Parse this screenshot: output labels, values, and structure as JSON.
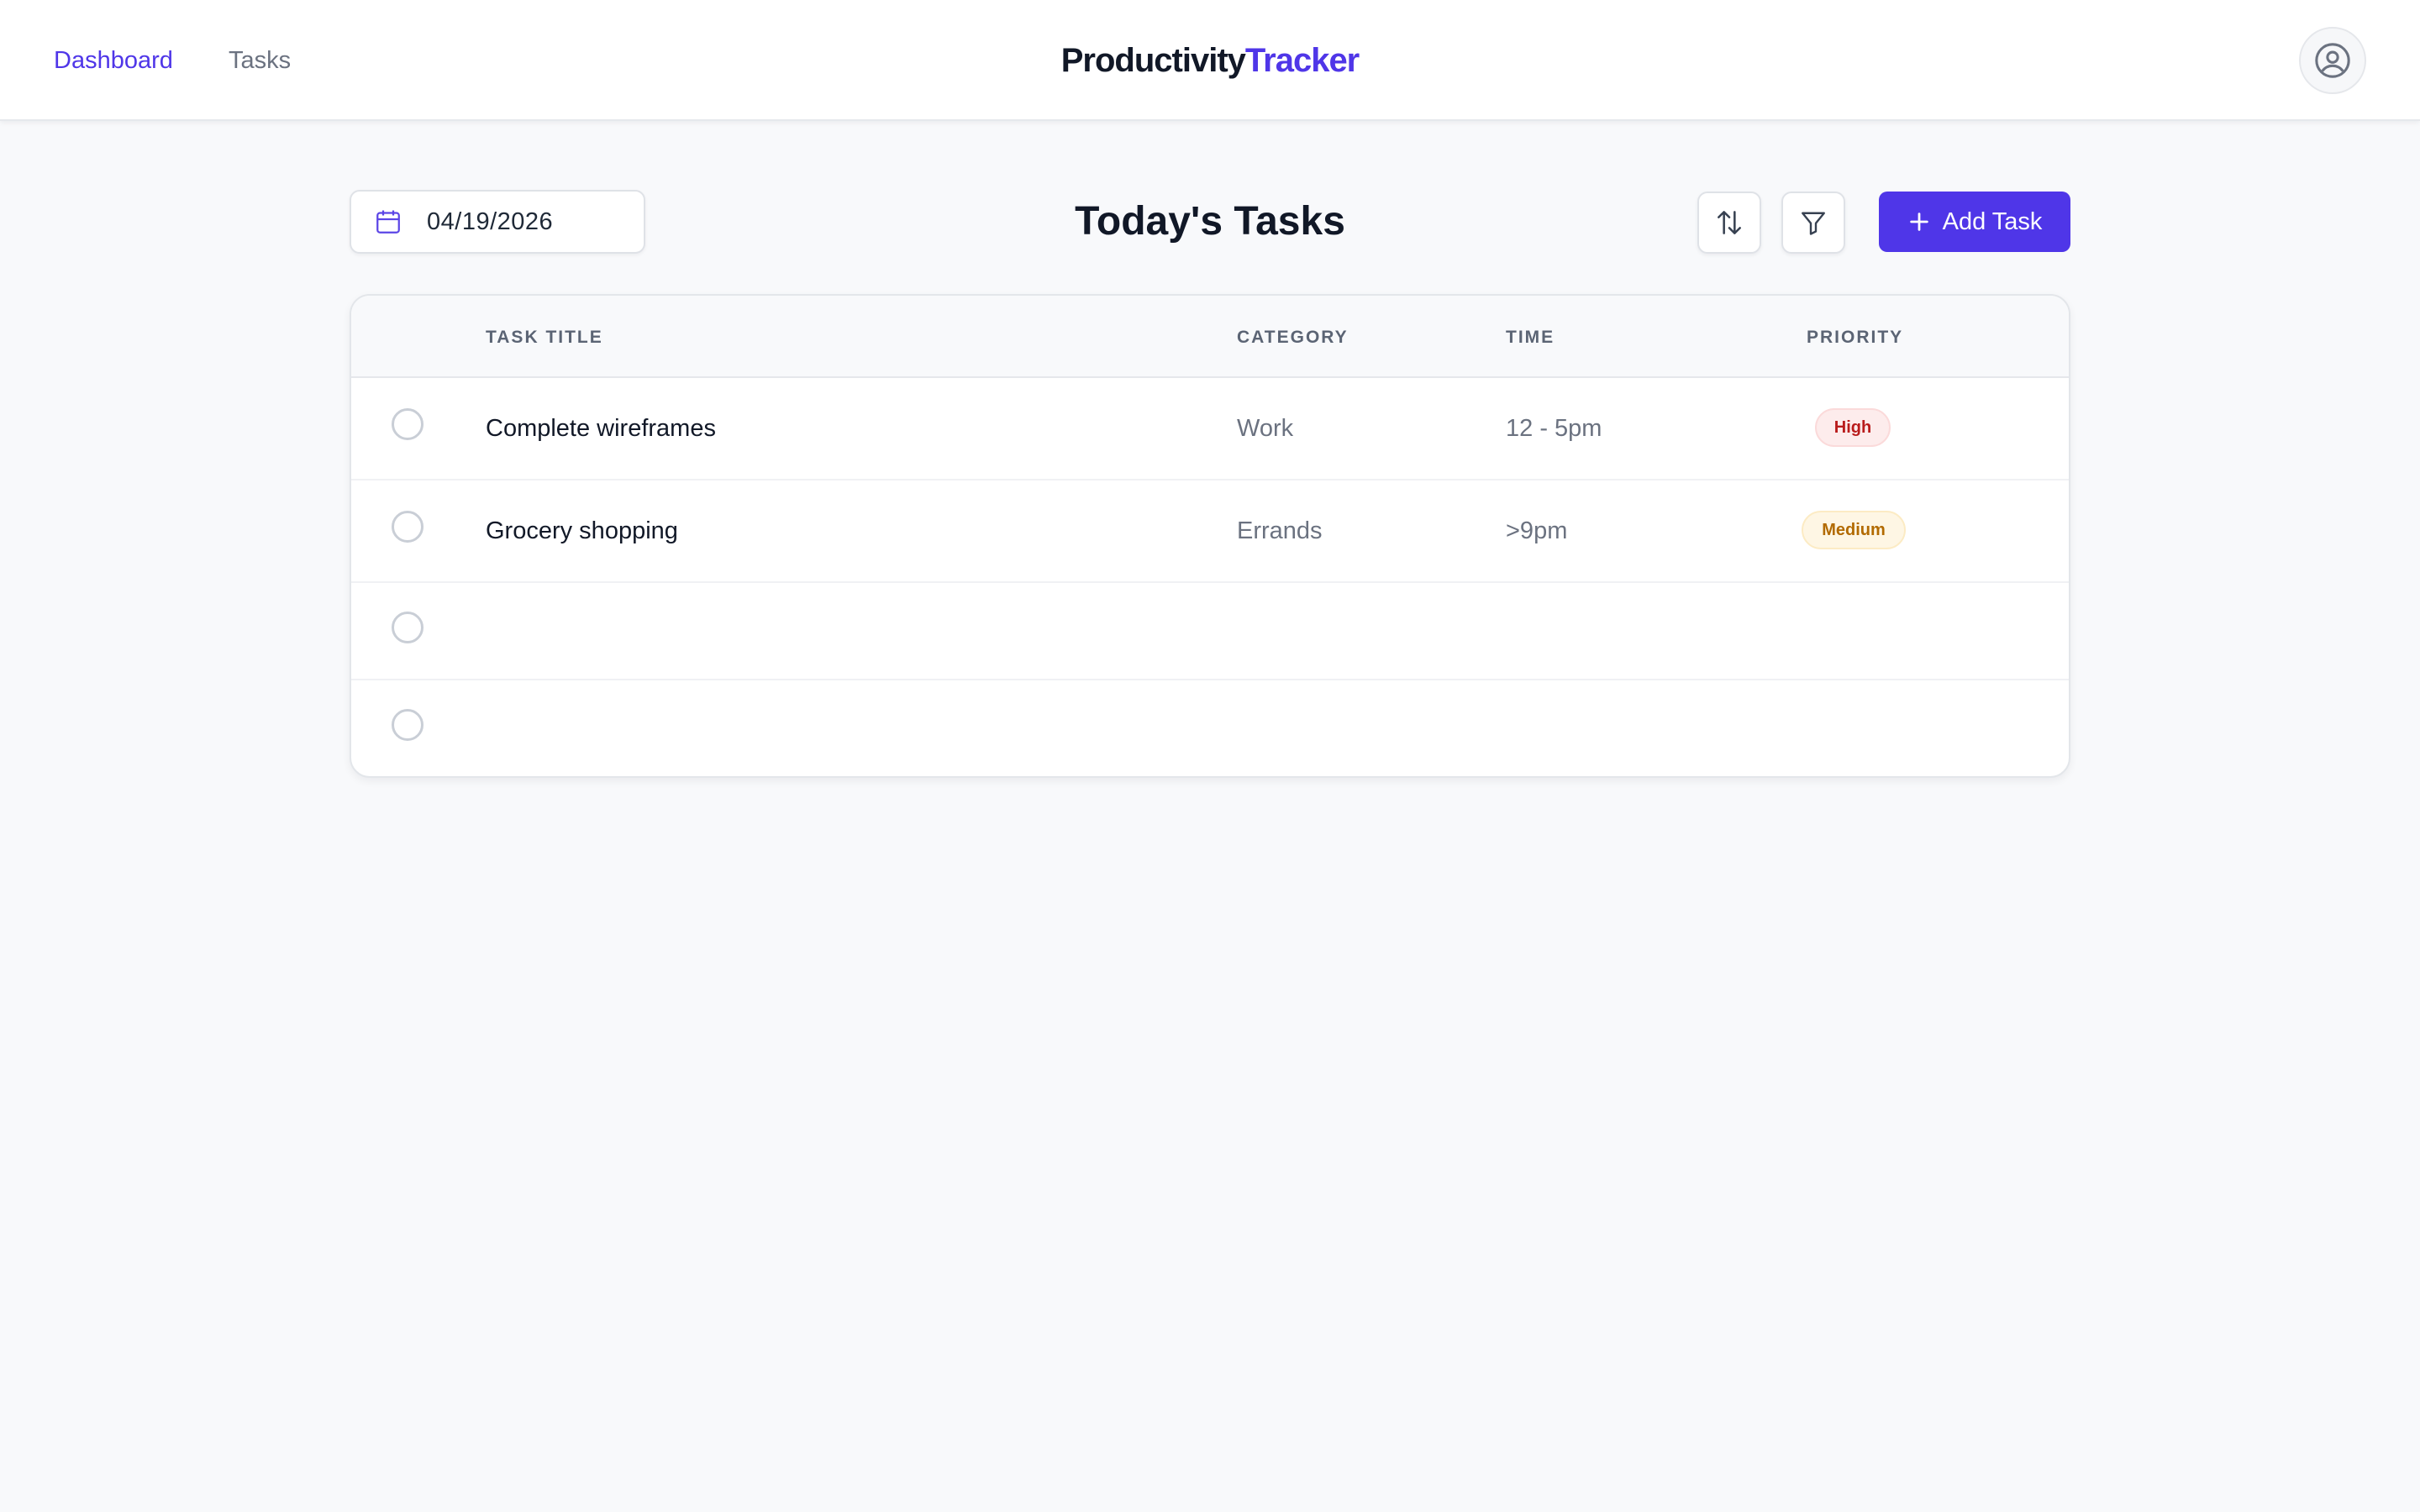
{
  "nav": {
    "links": [
      {
        "label": "Dashboard",
        "active": true
      },
      {
        "label": "Tasks",
        "active": false
      }
    ]
  },
  "brand": {
    "part1": "Productivity",
    "part2": "Tracker",
    "accent": "#4f36e8"
  },
  "user": {
    "avatar_icon": "user-circle-icon"
  },
  "toolbar": {
    "date_value": "04/19/2026",
    "date_icon": "calendar-icon",
    "title": "Today's Tasks",
    "sort_icon": "sort-arrows-icon",
    "filter_icon": "filter-icon",
    "add_label": "Add Task",
    "add_icon": "plus-icon"
  },
  "table": {
    "headers": [
      "TASK TITLE",
      "CATEGORY",
      "TIME",
      "PRIORITY"
    ],
    "rows": [
      {
        "title": "Complete wireframes",
        "category": "Work",
        "time": "12 - 5pm",
        "priority": "High",
        "done": false
      },
      {
        "title": "Grocery shopping",
        "category": "Errands",
        "time": ">9pm",
        "priority": "Medium",
        "done": false
      },
      {
        "title": "",
        "category": "",
        "time": "",
        "priority": "",
        "done": false
      },
      {
        "title": "",
        "category": "",
        "time": "",
        "priority": "",
        "done": false
      }
    ]
  },
  "colors": {
    "primary": "#4f36e8",
    "high_bg": "#fdecec",
    "high_text": "#b91c1c",
    "medium_bg": "#fef6e4",
    "medium_text": "#b26a00"
  }
}
